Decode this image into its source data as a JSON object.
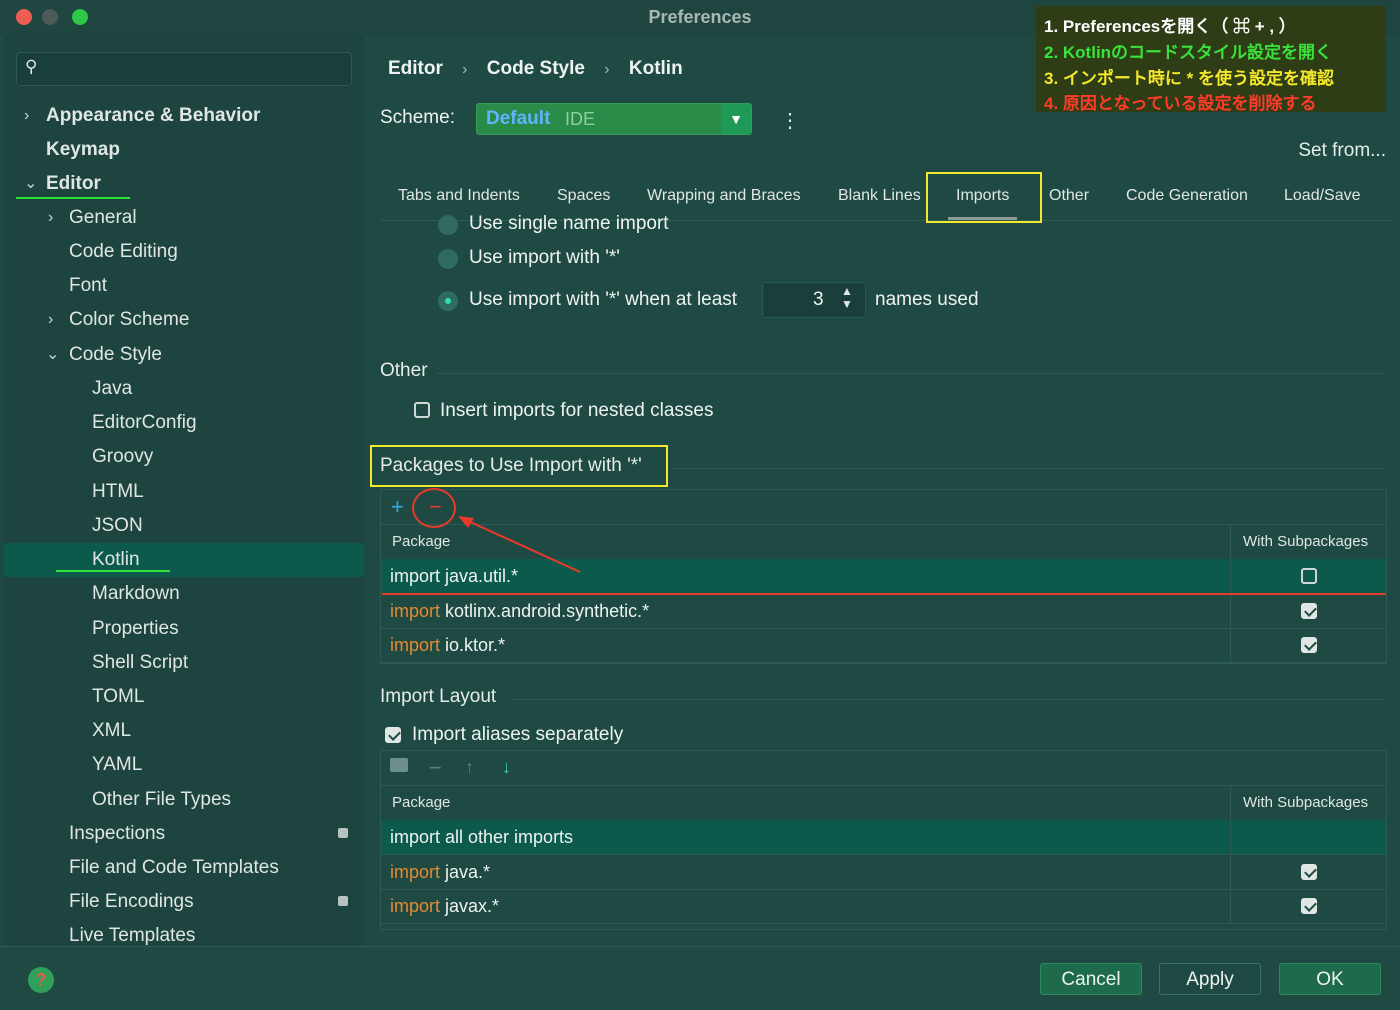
{
  "window": {
    "title": "Preferences"
  },
  "search": {
    "placeholder": ""
  },
  "sidebar": {
    "items": [
      {
        "label": "Appearance & Behavior"
      },
      {
        "label": "Keymap"
      },
      {
        "label": "Editor"
      },
      {
        "label": "General"
      },
      {
        "label": "Code Editing"
      },
      {
        "label": "Font"
      },
      {
        "label": "Color Scheme"
      },
      {
        "label": "Code Style"
      },
      {
        "label": "Java"
      },
      {
        "label": "EditorConfig"
      },
      {
        "label": "Groovy"
      },
      {
        "label": "HTML"
      },
      {
        "label": "JSON"
      },
      {
        "label": "Kotlin"
      },
      {
        "label": "Markdown"
      },
      {
        "label": "Properties"
      },
      {
        "label": "Shell Script"
      },
      {
        "label": "TOML"
      },
      {
        "label": "XML"
      },
      {
        "label": "YAML"
      },
      {
        "label": "Other File Types"
      },
      {
        "label": "Inspections"
      },
      {
        "label": "File and Code Templates"
      },
      {
        "label": "File Encodings"
      },
      {
        "label": "Live Templates"
      }
    ]
  },
  "breadcrumb": {
    "items": [
      "Editor",
      "Code Style",
      "Kotlin"
    ],
    "sep": "›"
  },
  "scheme": {
    "label": "Scheme:",
    "value": "Default",
    "suffix": "IDE"
  },
  "set_from": "Set from...",
  "tabs": [
    "Tabs and Indents",
    "Spaces",
    "Wrapping and Braces",
    "Blank Lines",
    "Imports",
    "Other",
    "Code Generation",
    "Load/Save"
  ],
  "imports": {
    "options": [
      {
        "label": "Use single name import",
        "selected": false
      },
      {
        "label": "Use import with '*'",
        "selected": false
      },
      {
        "label": "Use import with '*' when at least",
        "selected": true
      }
    ],
    "count": "3",
    "names_used": "names used"
  },
  "other": {
    "title": "Other",
    "nested_label": "Insert imports for nested classes",
    "nested_checked": false
  },
  "packages": {
    "title": "Packages to Use Import with '*'",
    "col_package": "Package",
    "col_sub": "With Subpackages",
    "rows": [
      {
        "kw": "",
        "text": "import java.util.*",
        "sub": false
      },
      {
        "kw": "import",
        "text": "kotlinx.android.synthetic.*",
        "sub": true
      },
      {
        "kw": "import",
        "text": "io.ktor.*",
        "sub": true
      }
    ]
  },
  "layout": {
    "title": "Import Layout",
    "aliases_label": "Import aliases separately",
    "aliases_checked": true,
    "col_package": "Package",
    "col_sub": "With Subpackages",
    "rows": [
      {
        "kw": "",
        "text": "import all other imports",
        "sub": null
      },
      {
        "kw": "import",
        "text": "java.*",
        "sub": true
      },
      {
        "kw": "import",
        "text": "javax.*",
        "sub": true
      }
    ]
  },
  "footer": {
    "cancel": "Cancel",
    "apply": "Apply",
    "ok": "OK",
    "help": "?"
  },
  "annotation": {
    "step1": "1. Preferencesを開く（ ⌘ + , ）",
    "step2": "2. Kotlinのコードスタイル設定を開く",
    "step3": "3. インポート時に * を使う設定を確認",
    "step4": "4. 原因となっている設定を削除する",
    "colors": {
      "step1": "#ffffff",
      "step2": "#39e23a",
      "step3": "#f3e829",
      "step4": "#ff3b2a"
    }
  },
  "colors": {
    "highlight_yellow": "#f3e829",
    "marker_red": "#e8392a",
    "marker_green": "#2fe03a",
    "keyword": "#e58a2e"
  }
}
